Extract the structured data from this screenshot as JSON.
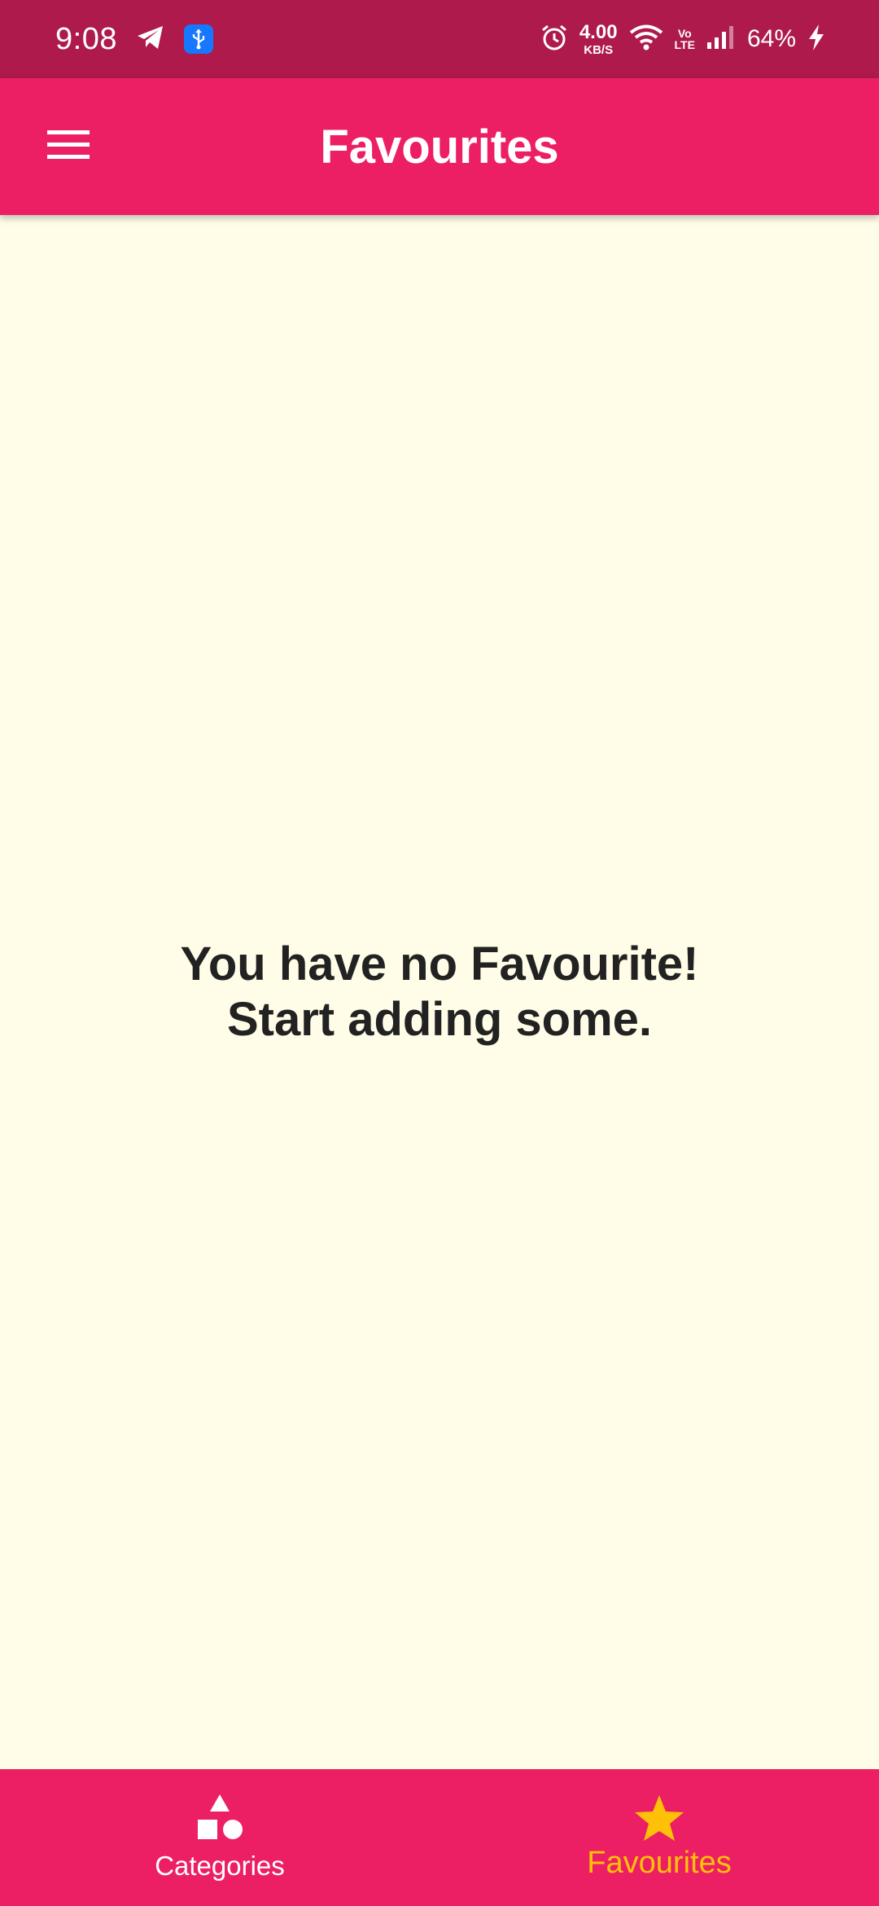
{
  "status_bar": {
    "time": "9:08",
    "net_speed_value": "4.00",
    "net_speed_unit": "KB/S",
    "volte_top": "Vo",
    "volte_bottom": "LTE",
    "battery_percent": "64%",
    "icons": [
      "telegram-icon",
      "usb-icon",
      "alarm-icon",
      "wifi-icon",
      "volte-icon",
      "signal-icon",
      "charging-icon"
    ]
  },
  "app_bar": {
    "title": "Favourites",
    "menu_icon": "hamburger-menu-icon"
  },
  "main": {
    "empty_line1": "You have no Favourite!",
    "empty_line2": "Start adding some."
  },
  "bottom_nav": {
    "items": [
      {
        "label": "Categories",
        "icon": "category-shapes-icon",
        "active": false
      },
      {
        "label": "Favourites",
        "icon": "star-icon",
        "active": true
      }
    ]
  },
  "colors": {
    "status_bar": "#AD1A4B",
    "primary": "#EC1F64",
    "background": "#FFFDE7",
    "accent": "#FFC107",
    "text_dark": "#222222"
  }
}
